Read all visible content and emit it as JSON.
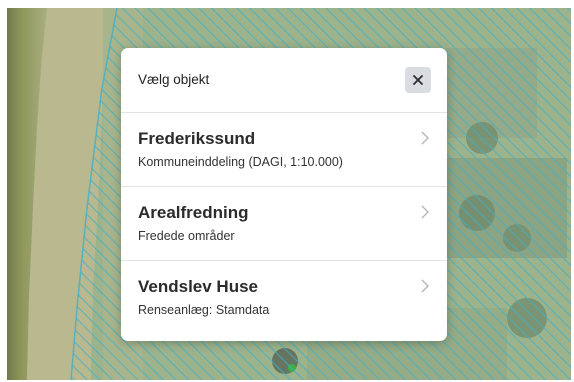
{
  "dialog": {
    "title": "Vælg objekt",
    "close_icon": "close-icon",
    "items": [
      {
        "title": "Frederikssund",
        "subtitle": "Kommuneinddeling (DAGI, 1:10.000)"
      },
      {
        "title": "Arealfredning",
        "subtitle": "Fredede områder"
      },
      {
        "title": "Vendslev Huse",
        "subtitle": "Renseanlæg: Stamdata"
      }
    ]
  },
  "map": {
    "hatch_color": "#3fb0c8",
    "background": "aerial-photo"
  }
}
